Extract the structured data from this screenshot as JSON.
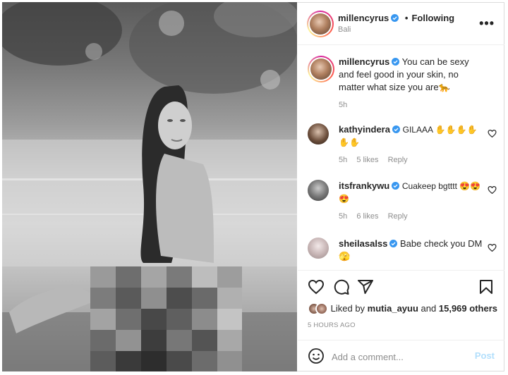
{
  "post": {
    "username": "millencyrus",
    "separator": "•",
    "following_label": "Following",
    "location": "Bali",
    "more_label": "•••"
  },
  "caption": {
    "username": "millencyrus",
    "text": "You can be sexy and feel good in your skin, no matter what size you are🐆",
    "time": "5h"
  },
  "comments": [
    {
      "username": "kathyindera",
      "text": "GILAAA ✋✋✋✋✋✋",
      "time": "5h",
      "likes": "5 likes",
      "reply": "Reply"
    },
    {
      "username": "itsfrankywu",
      "text": "Cuakeep bgtttt 😍😍😍",
      "time": "5h",
      "likes": "6 likes",
      "reply": "Reply"
    },
    {
      "username": "sheilasalss",
      "text": "Babe check you DM 🫣"
    }
  ],
  "likes": {
    "prefix": "Liked by",
    "user": "mutia_ayuu",
    "conjunction": "and",
    "others": "15,969 others"
  },
  "timestamp": "5 HOURS AGO",
  "composer": {
    "placeholder": "Add a comment...",
    "post_label": "Post"
  },
  "colors": {
    "verified": "#3897f0",
    "post_disabled": "#b2dffc",
    "meta_gray": "#8e8e8e"
  },
  "icons": [
    "verified-icon",
    "more-icon",
    "heart-icon",
    "comment-icon",
    "share-icon",
    "bookmark-icon",
    "emoji-icon"
  ]
}
